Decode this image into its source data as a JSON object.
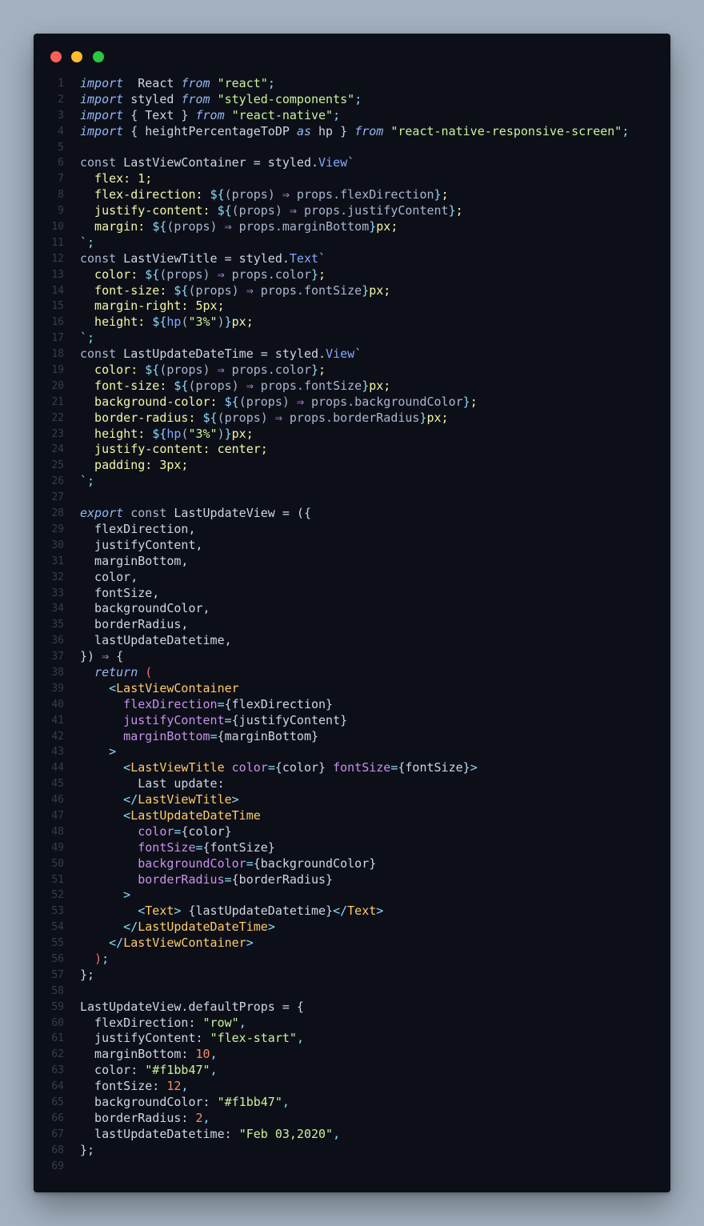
{
  "window": {
    "controls": [
      {
        "name": "close",
        "color": "#fe5f57"
      },
      {
        "name": "minimize",
        "color": "#febc2e"
      },
      {
        "name": "maximize",
        "color": "#28c840"
      }
    ]
  },
  "editor": {
    "lines": [
      {
        "n": "1",
        "tokens": [
          [
            "kw",
            "import"
          ],
          [
            "",
            "  React "
          ],
          [
            "kw",
            "from"
          ],
          [
            "",
            " "
          ],
          [
            "str",
            "\"react\""
          ],
          [
            "punc",
            ";"
          ]
        ]
      },
      {
        "n": "2",
        "tokens": [
          [
            "kw",
            "import"
          ],
          [
            "",
            " styled "
          ],
          [
            "kw",
            "from"
          ],
          [
            "",
            " "
          ],
          [
            "str",
            "\"styled-components\""
          ],
          [
            "punc",
            ";"
          ]
        ]
      },
      {
        "n": "3",
        "tokens": [
          [
            "kw",
            "import"
          ],
          [
            "",
            " { Text } "
          ],
          [
            "kw",
            "from"
          ],
          [
            "",
            " "
          ],
          [
            "str",
            "\"react-native\""
          ],
          [
            "punc",
            ";"
          ]
        ]
      },
      {
        "n": "4",
        "tokens": [
          [
            "kw",
            "import"
          ],
          [
            "",
            " { heightPercentageToDP "
          ],
          [
            "kw",
            "as"
          ],
          [
            "",
            " hp } "
          ],
          [
            "kw",
            "from"
          ],
          [
            "",
            " "
          ],
          [
            "str",
            "\"react-native-responsive-screen\""
          ],
          [
            "punc",
            ";"
          ]
        ]
      },
      {
        "n": "5",
        "tokens": []
      },
      {
        "n": "6",
        "tokens": [
          [
            "k2",
            "const"
          ],
          [
            "",
            " LastViewContainer = styled."
          ],
          [
            "fn",
            "View"
          ],
          [
            "punc",
            "`"
          ]
        ]
      },
      {
        "n": "7",
        "tokens": [
          [
            "prop",
            "  flex: 1;"
          ]
        ]
      },
      {
        "n": "8",
        "tokens": [
          [
            "prop",
            "  flex-direction: "
          ],
          [
            "punc",
            "${"
          ],
          [
            "var",
            "(props) "
          ],
          [
            "op",
            "⇒"
          ],
          [
            "var",
            " props.flexDirection"
          ],
          [
            "punc",
            "}"
          ],
          [
            "prop",
            ";"
          ]
        ]
      },
      {
        "n": "9",
        "tokens": [
          [
            "prop",
            "  justify-content: "
          ],
          [
            "punc",
            "${"
          ],
          [
            "var",
            "(props) "
          ],
          [
            "op",
            "⇒"
          ],
          [
            "var",
            " props.justifyContent"
          ],
          [
            "punc",
            "}"
          ],
          [
            "prop",
            ";"
          ]
        ]
      },
      {
        "n": "10",
        "tokens": [
          [
            "prop",
            "  margin: "
          ],
          [
            "punc",
            "${"
          ],
          [
            "var",
            "(props) "
          ],
          [
            "op",
            "⇒"
          ],
          [
            "var",
            " props.marginBottom"
          ],
          [
            "punc",
            "}"
          ],
          [
            "prop",
            "px;"
          ]
        ]
      },
      {
        "n": "11",
        "tokens": [
          [
            "punc",
            "`;"
          ]
        ]
      },
      {
        "n": "12",
        "tokens": [
          [
            "k2",
            "const"
          ],
          [
            "",
            " LastViewTitle = styled."
          ],
          [
            "fn",
            "Text"
          ],
          [
            "punc",
            "`"
          ]
        ]
      },
      {
        "n": "13",
        "tokens": [
          [
            "prop",
            "  color: "
          ],
          [
            "punc",
            "${"
          ],
          [
            "var",
            "(props) "
          ],
          [
            "op",
            "⇒"
          ],
          [
            "var",
            " props.color"
          ],
          [
            "punc",
            "}"
          ],
          [
            "prop",
            ";"
          ]
        ]
      },
      {
        "n": "14",
        "tokens": [
          [
            "prop",
            "  font-size: "
          ],
          [
            "punc",
            "${"
          ],
          [
            "var",
            "(props) "
          ],
          [
            "op",
            "⇒"
          ],
          [
            "var",
            " props.fontSize"
          ],
          [
            "punc",
            "}"
          ],
          [
            "prop",
            "px;"
          ]
        ]
      },
      {
        "n": "15",
        "tokens": [
          [
            "prop",
            "  margin-right: 5px;"
          ]
        ]
      },
      {
        "n": "16",
        "tokens": [
          [
            "prop",
            "  height: "
          ],
          [
            "punc",
            "${"
          ],
          [
            "fn",
            "hp"
          ],
          [
            "var",
            "("
          ],
          [
            "str",
            "\"3%\""
          ],
          [
            "var",
            ")"
          ],
          [
            "punc",
            "}"
          ],
          [
            "prop",
            "px;"
          ]
        ]
      },
      {
        "n": "17",
        "tokens": [
          [
            "punc",
            "`;"
          ]
        ]
      },
      {
        "n": "18",
        "tokens": [
          [
            "k2",
            "const"
          ],
          [
            "",
            " LastUpdateDateTime = styled."
          ],
          [
            "fn",
            "View"
          ],
          [
            "punc",
            "`"
          ]
        ]
      },
      {
        "n": "19",
        "tokens": [
          [
            "prop",
            "  color: "
          ],
          [
            "punc",
            "${"
          ],
          [
            "var",
            "(props) "
          ],
          [
            "op",
            "⇒"
          ],
          [
            "var",
            " props.color"
          ],
          [
            "punc",
            "}"
          ],
          [
            "prop",
            ";"
          ]
        ]
      },
      {
        "n": "20",
        "tokens": [
          [
            "prop",
            "  font-size: "
          ],
          [
            "punc",
            "${"
          ],
          [
            "var",
            "(props) "
          ],
          [
            "op",
            "⇒"
          ],
          [
            "var",
            " props.fontSize"
          ],
          [
            "punc",
            "}"
          ],
          [
            "prop",
            "px;"
          ]
        ]
      },
      {
        "n": "21",
        "tokens": [
          [
            "prop",
            "  background-color: "
          ],
          [
            "punc",
            "${"
          ],
          [
            "var",
            "(props) "
          ],
          [
            "op",
            "⇒"
          ],
          [
            "var",
            " props.backgroundColor"
          ],
          [
            "punc",
            "}"
          ],
          [
            "prop",
            ";"
          ]
        ]
      },
      {
        "n": "22",
        "tokens": [
          [
            "prop",
            "  border-radius: "
          ],
          [
            "punc",
            "${"
          ],
          [
            "var",
            "(props) "
          ],
          [
            "op",
            "⇒"
          ],
          [
            "var",
            " props.borderRadius"
          ],
          [
            "punc",
            "}"
          ],
          [
            "prop",
            "px;"
          ]
        ]
      },
      {
        "n": "23",
        "tokens": [
          [
            "prop",
            "  height: "
          ],
          [
            "punc",
            "${"
          ],
          [
            "fn",
            "hp"
          ],
          [
            "var",
            "("
          ],
          [
            "str",
            "\"3%\""
          ],
          [
            "var",
            ")"
          ],
          [
            "punc",
            "}"
          ],
          [
            "prop",
            "px;"
          ]
        ]
      },
      {
        "n": "24",
        "tokens": [
          [
            "prop",
            "  justify-content: center;"
          ]
        ]
      },
      {
        "n": "25",
        "tokens": [
          [
            "prop",
            "  padding: 3px;"
          ]
        ]
      },
      {
        "n": "26",
        "tokens": [
          [
            "punc",
            "`;"
          ]
        ]
      },
      {
        "n": "27",
        "tokens": []
      },
      {
        "n": "28",
        "tokens": [
          [
            "kw",
            "export"
          ],
          [
            "",
            " "
          ],
          [
            "k2",
            "const"
          ],
          [
            "",
            " LastUpdateView = ({"
          ]
        ]
      },
      {
        "n": "29",
        "tokens": [
          [
            "",
            "  flexDirection,"
          ]
        ]
      },
      {
        "n": "30",
        "tokens": [
          [
            "",
            "  justifyContent,"
          ]
        ]
      },
      {
        "n": "31",
        "tokens": [
          [
            "",
            "  marginBottom,"
          ]
        ]
      },
      {
        "n": "32",
        "tokens": [
          [
            "",
            "  color,"
          ]
        ]
      },
      {
        "n": "33",
        "tokens": [
          [
            "",
            "  fontSize,"
          ]
        ]
      },
      {
        "n": "34",
        "tokens": [
          [
            "",
            "  backgroundColor,"
          ]
        ]
      },
      {
        "n": "35",
        "tokens": [
          [
            "",
            "  borderRadius,"
          ]
        ]
      },
      {
        "n": "36",
        "tokens": [
          [
            "",
            "  lastUpdateDatetime,"
          ]
        ]
      },
      {
        "n": "37",
        "tokens": [
          [
            "",
            "}) "
          ],
          [
            "op",
            "⇒"
          ],
          [
            "",
            " {"
          ]
        ]
      },
      {
        "n": "38",
        "tokens": [
          [
            "",
            "  "
          ],
          [
            "kw",
            "return"
          ],
          [
            "",
            " "
          ],
          [
            "paren",
            "("
          ]
        ]
      },
      {
        "n": "39",
        "tokens": [
          [
            "punc",
            "    <"
          ],
          [
            "tag",
            "LastViewContainer"
          ]
        ]
      },
      {
        "n": "40",
        "tokens": [
          [
            "attr",
            "      flexDirection"
          ],
          [
            "punc",
            "="
          ],
          [
            "",
            "{flexDirection}"
          ]
        ]
      },
      {
        "n": "41",
        "tokens": [
          [
            "attr",
            "      justifyContent"
          ],
          [
            "punc",
            "="
          ],
          [
            "",
            "{justifyContent}"
          ]
        ]
      },
      {
        "n": "42",
        "tokens": [
          [
            "attr",
            "      marginBottom"
          ],
          [
            "punc",
            "="
          ],
          [
            "",
            "{marginBottom}"
          ]
        ]
      },
      {
        "n": "43",
        "tokens": [
          [
            "punc",
            "    >"
          ]
        ]
      },
      {
        "n": "44",
        "tokens": [
          [
            "punc",
            "      <"
          ],
          [
            "tag",
            "LastViewTitle"
          ],
          [
            "",
            " "
          ],
          [
            "attr",
            "color"
          ],
          [
            "punc",
            "="
          ],
          [
            "",
            "{color} "
          ],
          [
            "attr",
            "fontSize"
          ],
          [
            "punc",
            "="
          ],
          [
            "",
            "{fontSize}"
          ],
          [
            "punc",
            ">"
          ]
        ]
      },
      {
        "n": "45",
        "tokens": [
          [
            "",
            "        Last update:"
          ]
        ]
      },
      {
        "n": "46",
        "tokens": [
          [
            "punc",
            "      </"
          ],
          [
            "tag",
            "LastViewTitle"
          ],
          [
            "punc",
            ">"
          ]
        ]
      },
      {
        "n": "47",
        "tokens": [
          [
            "punc",
            "      <"
          ],
          [
            "tag",
            "LastUpdateDateTime"
          ]
        ]
      },
      {
        "n": "48",
        "tokens": [
          [
            "attr",
            "        color"
          ],
          [
            "punc",
            "="
          ],
          [
            "",
            "{color}"
          ]
        ]
      },
      {
        "n": "49",
        "tokens": [
          [
            "attr",
            "        fontSize"
          ],
          [
            "punc",
            "="
          ],
          [
            "",
            "{fontSize}"
          ]
        ]
      },
      {
        "n": "50",
        "tokens": [
          [
            "attr",
            "        backgroundColor"
          ],
          [
            "punc",
            "="
          ],
          [
            "",
            "{backgroundColor}"
          ]
        ]
      },
      {
        "n": "51",
        "tokens": [
          [
            "attr",
            "        borderRadius"
          ],
          [
            "punc",
            "="
          ],
          [
            "",
            "{borderRadius}"
          ]
        ]
      },
      {
        "n": "52",
        "tokens": [
          [
            "punc",
            "      >"
          ]
        ]
      },
      {
        "n": "53",
        "tokens": [
          [
            "punc",
            "        <"
          ],
          [
            "tag",
            "Text"
          ],
          [
            "punc",
            ">"
          ],
          [
            "",
            " {lastUpdateDatetime}"
          ],
          [
            "punc",
            "</"
          ],
          [
            "tag",
            "Text"
          ],
          [
            "punc",
            ">"
          ]
        ]
      },
      {
        "n": "54",
        "tokens": [
          [
            "punc",
            "      </"
          ],
          [
            "tag",
            "LastUpdateDateTime"
          ],
          [
            "punc",
            ">"
          ]
        ]
      },
      {
        "n": "55",
        "tokens": [
          [
            "punc",
            "    </"
          ],
          [
            "tag",
            "LastViewContainer"
          ],
          [
            "punc",
            ">"
          ]
        ]
      },
      {
        "n": "56",
        "tokens": [
          [
            "",
            "  "
          ],
          [
            "paren",
            ")"
          ],
          [
            "punc",
            ";"
          ]
        ]
      },
      {
        "n": "57",
        "tokens": [
          [
            "",
            "};"
          ]
        ]
      },
      {
        "n": "58",
        "tokens": []
      },
      {
        "n": "59",
        "tokens": [
          [
            "",
            "LastUpdateView.defaultProps = {"
          ]
        ]
      },
      {
        "n": "60",
        "tokens": [
          [
            "",
            "  flexDirection: "
          ],
          [
            "str",
            "\"row\""
          ],
          [
            "punc",
            ","
          ]
        ]
      },
      {
        "n": "61",
        "tokens": [
          [
            "",
            "  justifyContent: "
          ],
          [
            "str",
            "\"flex-start\""
          ],
          [
            "punc",
            ","
          ]
        ]
      },
      {
        "n": "62",
        "tokens": [
          [
            "",
            "  marginBottom: "
          ],
          [
            "num",
            "10"
          ],
          [
            "punc",
            ","
          ]
        ]
      },
      {
        "n": "63",
        "tokens": [
          [
            "",
            "  color: "
          ],
          [
            "str",
            "\"#f1bb47\""
          ],
          [
            "punc",
            ","
          ]
        ]
      },
      {
        "n": "64",
        "tokens": [
          [
            "",
            "  fontSize: "
          ],
          [
            "num",
            "12"
          ],
          [
            "punc",
            ","
          ]
        ]
      },
      {
        "n": "65",
        "tokens": [
          [
            "",
            "  backgroundColor: "
          ],
          [
            "str",
            "\"#f1bb47\""
          ],
          [
            "punc",
            ","
          ]
        ]
      },
      {
        "n": "66",
        "tokens": [
          [
            "",
            "  borderRadius: "
          ],
          [
            "num",
            "2"
          ],
          [
            "punc",
            ","
          ]
        ]
      },
      {
        "n": "67",
        "tokens": [
          [
            "",
            "  lastUpdateDatetime: "
          ],
          [
            "str",
            "\"Feb 03,2020\""
          ],
          [
            "punc",
            ","
          ]
        ]
      },
      {
        "n": "68",
        "tokens": [
          [
            "",
            "};"
          ]
        ]
      },
      {
        "n": "69",
        "tokens": []
      }
    ]
  }
}
